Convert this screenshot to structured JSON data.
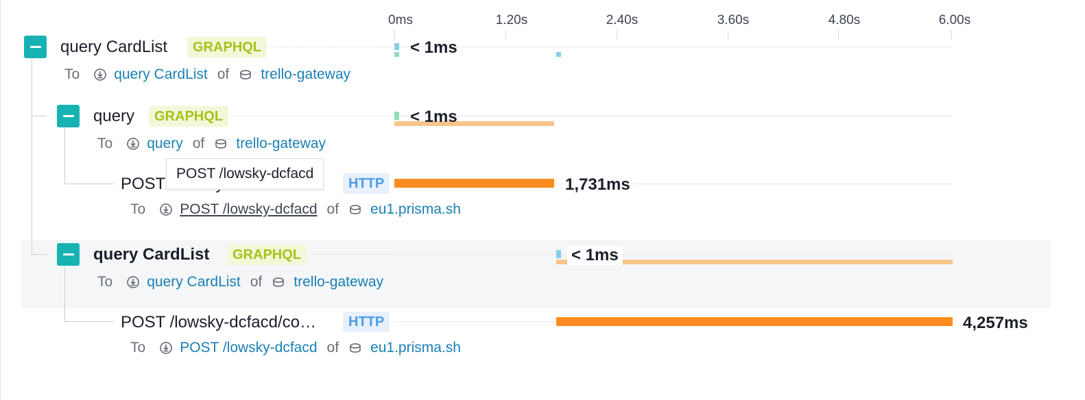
{
  "axis": {
    "ticks": [
      "0ms",
      "1.20s",
      "2.40s",
      "3.60s",
      "4.80s",
      "6.00s"
    ]
  },
  "spans": [
    {
      "name": "query CardList",
      "badge": "GRAPHQL",
      "duration": "< 1ms",
      "sub": {
        "to_label": "To",
        "operation": "query CardList",
        "of_label": "of",
        "service": "trello-gateway"
      }
    },
    {
      "name": "query",
      "badge": "GRAPHQL",
      "duration": "< 1ms",
      "sub": {
        "to_label": "To",
        "operation": "query",
        "of_label": "of",
        "service": "trello-gateway"
      }
    },
    {
      "name": "POST /lowsky-dcfacd/co…",
      "badge": "HTTP",
      "duration": "1,731ms",
      "sub": {
        "to_label": "To",
        "operation": "POST /lowsky-dcfacd",
        "of_label": "of",
        "service": "eu1.prisma.sh"
      }
    },
    {
      "name": "query CardList",
      "badge": "GRAPHQL",
      "duration": "< 1ms",
      "sub": {
        "to_label": "To",
        "operation": "query CardList",
        "of_label": "of",
        "service": "trello-gateway"
      }
    },
    {
      "name": "POST /lowsky-dcfacd/co…",
      "badge": "HTTP",
      "duration": "4,257ms",
      "sub": {
        "to_label": "To",
        "operation": "POST /lowsky-dcfacd",
        "of_label": "of",
        "service": "eu1.prisma.sh"
      }
    }
  ],
  "tooltip": {
    "text": "POST /lowsky-dcfacd"
  },
  "colors": {
    "toggle": "#17b3b3",
    "graphql_badge": "#a6c21a",
    "http_badge": "#4a9ce8",
    "bar_orange": "#fb8c1f",
    "bar_light_orange": "#fbc48a",
    "link": "#1a7fb4"
  },
  "icons": {
    "operation": "operation-download-icon",
    "service": "database-icon",
    "toggle": "minus-icon"
  }
}
